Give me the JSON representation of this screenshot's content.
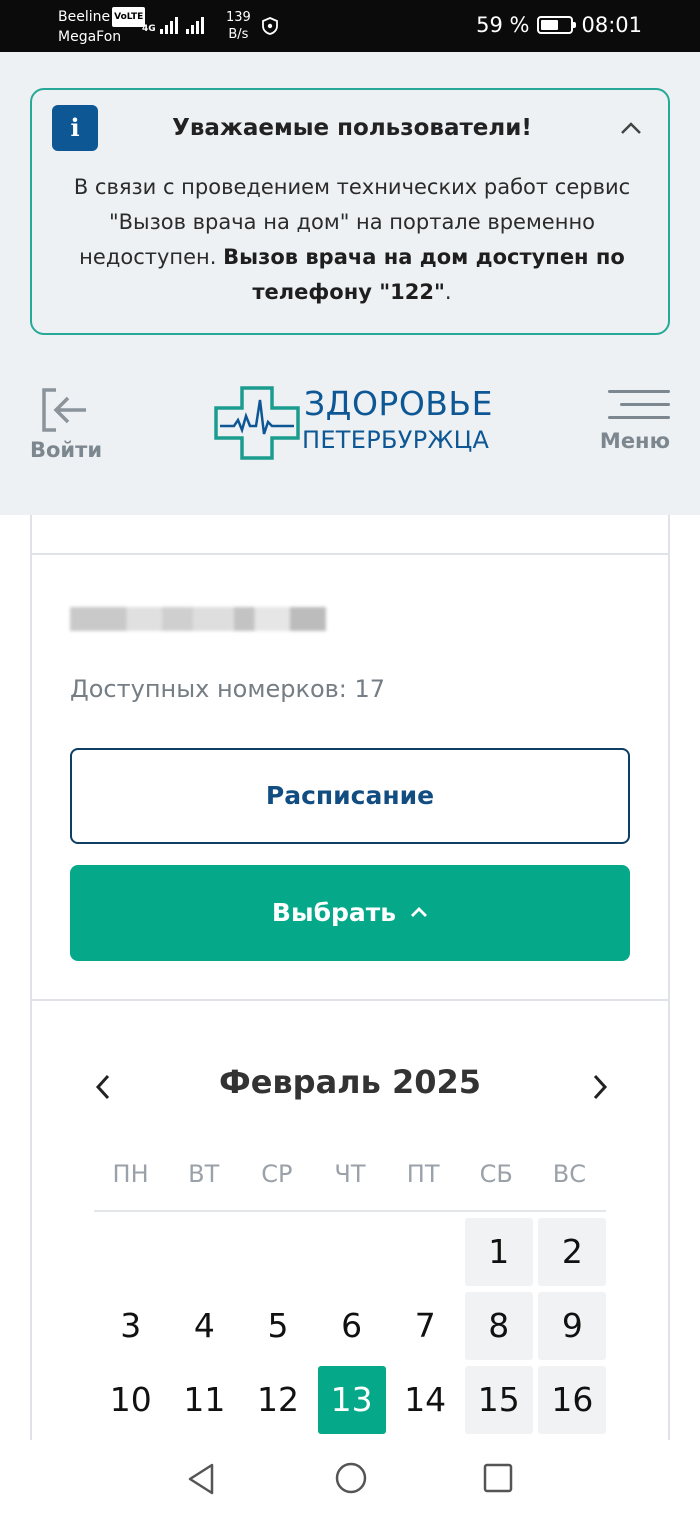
{
  "status_bar": {
    "carrier1": "Beeline",
    "volte": "VoLTE",
    "carrier2": "MegaFon",
    "network": "4G",
    "speed_value": "139",
    "speed_unit": "B/s",
    "battery": "59 %",
    "battery_level": 0.59,
    "time": "08:01"
  },
  "notice": {
    "icon": "info-icon",
    "title": "Уважаемые пользователи!",
    "text_plain": "В связи с проведением технических работ сервис \"Вызов врача на дом\" на портале временно недоступен.",
    "text_bold": "Вызов врача на дом доступен по телефону \"122\"",
    "text_end": "."
  },
  "header": {
    "login_label": "Войти",
    "logo_line1": "ЗДОРОВЬЕ",
    "logo_line2": "ПЕТЕРБУРЖЦА",
    "menu_label": "Меню"
  },
  "card": {
    "available_label": "Доступных номерков: 17",
    "schedule_button": "Расписание",
    "choose_button": "Выбрать"
  },
  "calendar": {
    "month_title": "Февраль 2025",
    "weekdays": [
      "ПН",
      "ВТ",
      "СР",
      "ЧТ",
      "ПТ",
      "СБ",
      "ВС"
    ],
    "selected_day": "13",
    "rows": [
      [
        {
          "n": "",
          "t": ""
        },
        {
          "n": "",
          "t": ""
        },
        {
          "n": "",
          "t": ""
        },
        {
          "n": "",
          "t": ""
        },
        {
          "n": "",
          "t": ""
        },
        {
          "n": "1",
          "t": "wk"
        },
        {
          "n": "2",
          "t": "wk"
        }
      ],
      [
        {
          "n": "3",
          "t": ""
        },
        {
          "n": "4",
          "t": ""
        },
        {
          "n": "5",
          "t": ""
        },
        {
          "n": "6",
          "t": ""
        },
        {
          "n": "7",
          "t": ""
        },
        {
          "n": "8",
          "t": "wk"
        },
        {
          "n": "9",
          "t": "wk"
        }
      ],
      [
        {
          "n": "10",
          "t": ""
        },
        {
          "n": "11",
          "t": ""
        },
        {
          "n": "12",
          "t": ""
        },
        {
          "n": "13",
          "t": "sel"
        },
        {
          "n": "14",
          "t": ""
        },
        {
          "n": "15",
          "t": "wk"
        },
        {
          "n": "16",
          "t": "wk"
        }
      ]
    ]
  },
  "colors": {
    "accent_green": "#05a98a",
    "brand_blue": "#0d5795",
    "notice_border": "#26a997",
    "weekend_bg": "#f1f2f3"
  }
}
